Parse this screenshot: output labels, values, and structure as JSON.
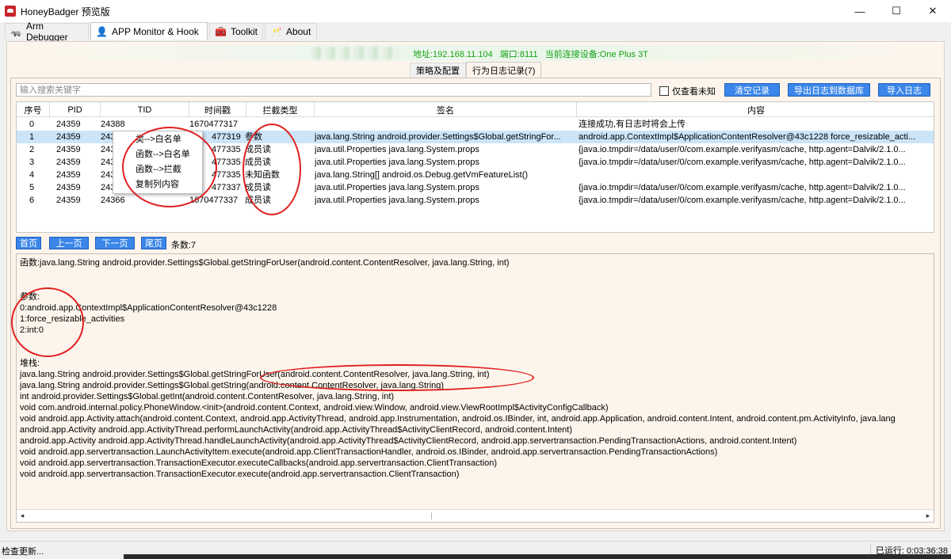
{
  "window": {
    "title": "HoneyBadger 预览版",
    "minimize": "—",
    "maximize": "☐",
    "close": "✕"
  },
  "tabs": [
    {
      "label": "Arm Debugger",
      "icon": "badger-icon"
    },
    {
      "label": "APP Monitor & Hook",
      "icon": "person-icon"
    },
    {
      "label": "Toolkit",
      "icon": "toolkit-icon"
    },
    {
      "label": "About",
      "icon": "about-icon"
    }
  ],
  "device": {
    "address": "地址:192.168.11.104",
    "port": "端口:8111",
    "current": "当前连接设备:One Plus 3T"
  },
  "subtabs": {
    "policy": "策略及配置",
    "log": "行为日志记录(7)"
  },
  "toolbar": {
    "search_placeholder": "输入搜索关键字",
    "only_unknown": "仅查看未知",
    "clear": "清空记录",
    "export_db": "导出日志到数据库",
    "import": "导入日志"
  },
  "table": {
    "columns": [
      "序号",
      "PID",
      "TID",
      "时间戳",
      "拦截类型",
      "签名",
      "内容"
    ],
    "rows": [
      [
        "0",
        "24359",
        "24388",
        "1670477317",
        "",
        "",
        "连接成功,有日志时将会上传"
      ],
      [
        "1",
        "24359",
        "2435",
        "477319",
        "参数",
        "java.lang.String android.provider.Settings$Global.getStringFor...",
        "android.app.ContextImpl$ApplicationContentResolver@43c1228 force_resizable_acti..."
      ],
      [
        "2",
        "24359",
        "2436",
        "477335",
        "成员读",
        "java.util.Properties java.lang.System.props",
        "{java.io.tmpdir=/data/user/0/com.example.verifyasm/cache, http.agent=Dalvik/2.1.0..."
      ],
      [
        "3",
        "24359",
        "2436",
        "477335",
        "成员读",
        "java.util.Properties java.lang.System.props",
        "{java.io.tmpdir=/data/user/0/com.example.verifyasm/cache, http.agent=Dalvik/2.1.0..."
      ],
      [
        "4",
        "24359",
        "2436",
        "477335",
        "未知函数",
        "java.lang.String[] android.os.Debug.getVmFeatureList()",
        ""
      ],
      [
        "5",
        "24359",
        "2436",
        "477337",
        "成员读",
        "java.util.Properties java.lang.System.props",
        "{java.io.tmpdir=/data/user/0/com.example.verifyasm/cache, http.agent=Dalvik/2.1.0..."
      ],
      [
        "6",
        "24359",
        "24366",
        "1670477337",
        "成员读",
        "java.util.Properties java.lang.System.props",
        "{java.io.tmpdir=/data/user/0/com.example.verifyasm/cache, http.agent=Dalvik/2.1.0..."
      ]
    ]
  },
  "context_menu": {
    "items": [
      "类-->白名单",
      "函数-->白名单",
      "函数-->拦截",
      "复制列内容"
    ]
  },
  "pager": {
    "first": "首页",
    "prev": "上一页",
    "next": "下一页",
    "last": "尾页",
    "count": "条数:7"
  },
  "detail": {
    "lines": [
      "函数:java.lang.String android.provider.Settings$Global.getStringForUser(android.content.ContentResolver, java.lang.String, int)",
      "",
      "",
      "参数:",
      "0:android.app.ContextImpl$ApplicationContentResolver@43c1228",
      "1:force_resizable_activities",
      "2:int:0",
      "",
      "",
      "堆栈:",
      "java.lang.String android.provider.Settings$Global.getStringForUser(android.content.ContentResolver, java.lang.String, int)",
      "java.lang.String android.provider.Settings$Global.getString(android.content.ContentResolver, java.lang.String)",
      "int android.provider.Settings$Global.getInt(android.content.ContentResolver, java.lang.String, int)",
      "void com.android.internal.policy.PhoneWindow.<init>(android.content.Context, android.view.Window, android.view.ViewRootImpl$ActivityConfigCallback)",
      "void android.app.Activity.attach(android.content.Context, android.app.ActivityThread, android.app.Instrumentation, android.os.IBinder, int, android.app.Application, android.content.Intent, android.content.pm.ActivityInfo, java.lang",
      "android.app.Activity android.app.ActivityThread.performLaunchActivity(android.app.ActivityThread$ActivityClientRecord, android.content.Intent)",
      "android.app.Activity android.app.ActivityThread.handleLaunchActivity(android.app.ActivityThread$ActivityClientRecord, android.app.servertransaction.PendingTransactionActions, android.content.Intent)",
      "void android.app.servertransaction.LaunchActivityItem.execute(android.app.ClientTransactionHandler, android.os.IBinder, android.app.servertransaction.PendingTransactionActions)",
      "void android.app.servertransaction.TransactionExecutor.executeCallbacks(android.app.servertransaction.ClientTransaction)",
      "void android.app.servertransaction.TransactionExecutor.execute(android.app.servertransaction.ClientTransaction)"
    ],
    "scroll_left": "◂",
    "scroll_right": "▸"
  },
  "status": {
    "left": "检查更新...",
    "right": "已运行: 0:03:36:38"
  },
  "colors": {
    "accent_button": "#3b86e8",
    "device_text": "#12a312",
    "annotation": "#e02020",
    "selected_row": "#cce4f7"
  }
}
